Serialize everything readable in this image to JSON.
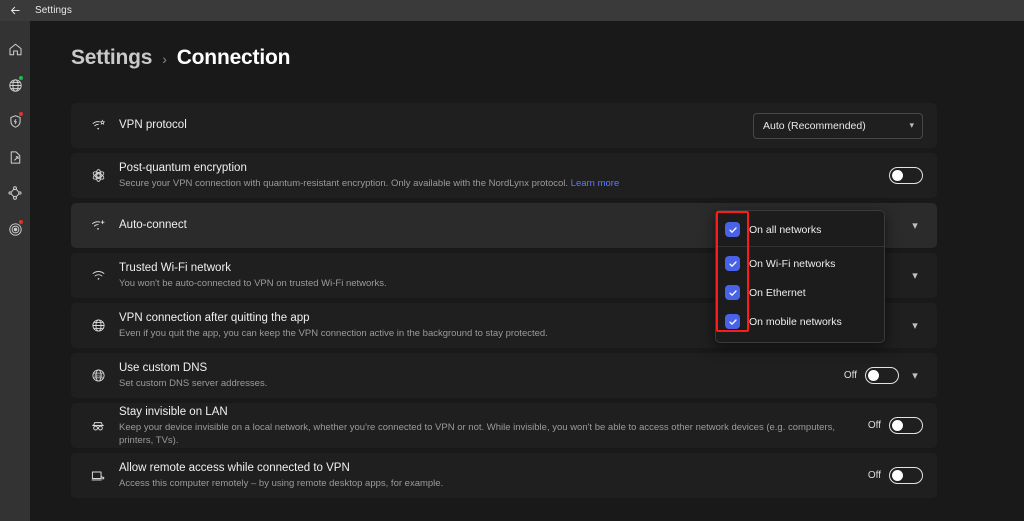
{
  "titlebar": {
    "back_icon": "back-arrow-icon",
    "title": "Settings"
  },
  "sidebar": {
    "items": [
      {
        "name": "home",
        "icon": "home-icon",
        "badge": ""
      },
      {
        "name": "vpn-globe",
        "icon": "globe-icon",
        "badge": "green"
      },
      {
        "name": "threat-protection",
        "icon": "shield-bolt-icon",
        "badge": "red"
      },
      {
        "name": "file-share",
        "icon": "file-share-icon",
        "badge": ""
      },
      {
        "name": "meshnet",
        "icon": "meshnet-icon",
        "badge": ""
      },
      {
        "name": "dark-web-monitor",
        "icon": "radar-icon",
        "badge": "red"
      }
    ]
  },
  "breadcrumb": {
    "parent": "Settings",
    "separator": "›",
    "current": "Connection"
  },
  "rows": [
    {
      "id": "vpn-protocol",
      "icon": "wifi-star-icon",
      "title": "VPN protocol",
      "desc": "",
      "control": "select",
      "select_value": "Auto (Recommended)"
    },
    {
      "id": "post-quantum-encryption",
      "icon": "atom-icon",
      "title": "Post-quantum encryption",
      "desc": "Secure your VPN connection with quantum-resistant encryption. Only available with the NordLynx protocol. ",
      "desc_link": "Learn more",
      "control": "toggle",
      "toggle_state": "off",
      "toggle_label": ""
    },
    {
      "id": "auto-connect",
      "icon": "wifi-plus-icon",
      "title": "Auto-connect",
      "desc": "",
      "control": "chevron",
      "highlighted": true
    },
    {
      "id": "trusted-wifi-network",
      "icon": "wifi-icon",
      "title": "Trusted Wi-Fi network",
      "desc": "You won't be auto-connected to VPN on trusted Wi-Fi networks.",
      "control": "chevron"
    },
    {
      "id": "vpn-connection-after-quitting",
      "icon": "globe-icon",
      "title": "VPN connection after quitting the app",
      "desc": "Even if you quit the app, you can keep the VPN connection active in the background to stay protected.",
      "control": "chevron"
    },
    {
      "id": "use-custom-dns",
      "icon": "dns-globe-icon",
      "title": "Use custom DNS",
      "desc": "Set custom DNS server addresses.",
      "control": "toggle-chevron",
      "toggle_state": "off",
      "toggle_label": "Off"
    },
    {
      "id": "stay-invisible-on-lan",
      "icon": "incognito-icon",
      "title": "Stay invisible on LAN",
      "desc": "Keep your device invisible on a local network, whether you're connected to VPN or not. While invisible, you won't be able to access other network devices (e.g. computers, printers, TVs).",
      "control": "toggle",
      "toggle_state": "off",
      "toggle_label": "Off"
    },
    {
      "id": "allow-remote-access",
      "icon": "remote-desktop-icon",
      "title": "Allow remote access while connected to VPN",
      "desc": "Access this computer remotely – by using remote desktop apps, for example.",
      "control": "toggle",
      "toggle_state": "off",
      "toggle_label": "Off"
    }
  ],
  "dropdown": {
    "open_for": "auto-connect",
    "items": [
      {
        "label": "On all networks",
        "checked": true
      },
      {
        "label": "On Wi-Fi networks",
        "checked": true
      },
      {
        "label": "On Ethernet",
        "checked": true
      },
      {
        "label": "On mobile networks",
        "checked": true
      }
    ]
  },
  "annotation": {
    "type": "red-highlight-box",
    "target": "dropdown-checkbox-column",
    "color": "#fb1b1b"
  },
  "colors": {
    "accent_checkbox": "#4963e8",
    "link": "#5b7cff",
    "badge_green": "#1db954",
    "badge_red": "#e4322b",
    "page_bg": "#191919",
    "card_bg": "#1f1f1f",
    "card_bg_highlight": "#2b2b2b"
  }
}
